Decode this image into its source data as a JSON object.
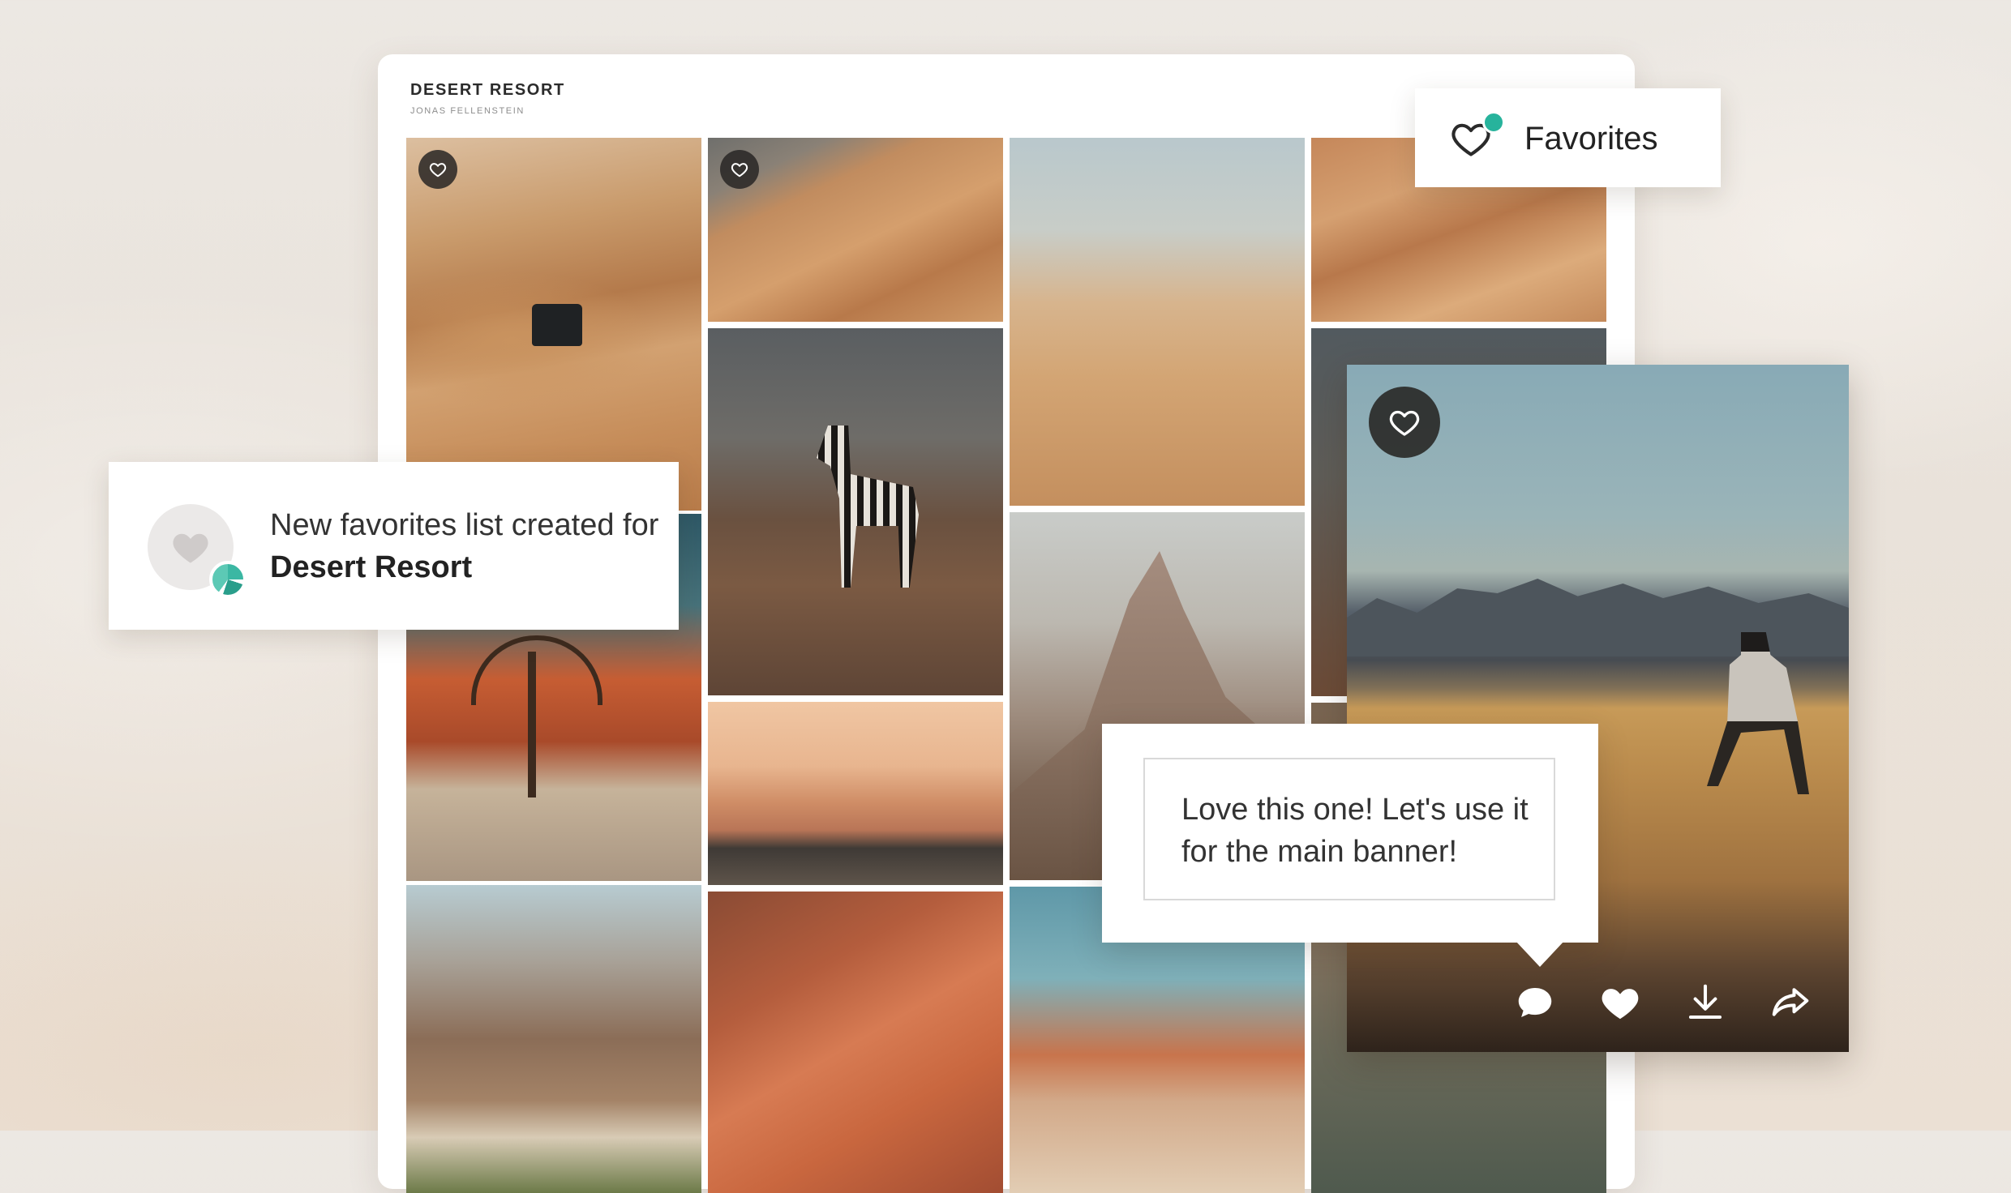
{
  "gallery": {
    "title": "DESERT RESORT",
    "author": "JONAS FELLENSTEIN"
  },
  "favorites_chip": {
    "label": "Favorites",
    "icon": "heart-outline-icon",
    "indicator_color": "#27b39c"
  },
  "notification": {
    "text_prefix": "New favorites list created for ",
    "text_highlight": "Desert Resort",
    "icon": "heart-icon"
  },
  "comment": {
    "text": "Love this one! Let's use it for the main banner!"
  },
  "preview": {
    "actions": [
      {
        "name": "comment",
        "icon": "comment-icon"
      },
      {
        "name": "favorite",
        "icon": "heart-filled-icon"
      },
      {
        "name": "download",
        "icon": "download-icon"
      },
      {
        "name": "share",
        "icon": "share-icon"
      }
    ]
  },
  "colors": {
    "accent": "#27b39c",
    "text_dark": "#222222"
  }
}
